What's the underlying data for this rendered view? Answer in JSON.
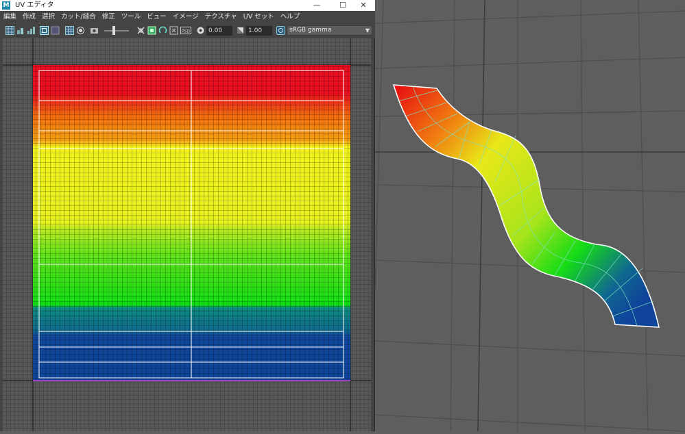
{
  "window": {
    "title": "UV エディタ",
    "logo_letter": "M",
    "controls": {
      "minimize": "—",
      "maximize": "☐",
      "close": "✕"
    }
  },
  "menu": [
    "編集",
    "作成",
    "選択",
    "カット/縫合",
    "修正",
    "ツール",
    "ビュー",
    "イメージ",
    "テクスチャ",
    "UV セット",
    "ヘルプ"
  ],
  "toolbar": {
    "exposure_value": "0.00",
    "gamma_value": "1.00",
    "color_space": "sRGB gamma",
    "icons": [
      "uv-grid-icon",
      "checker-icon",
      "stats-icon",
      "frame-icon",
      "shaded-icon",
      "grid-toggle-icon",
      "snapshot-icon",
      "display-image-icon",
      "dim-image-icon",
      "image-filter-icon",
      "texture-borders-icon",
      "distortion-icon",
      "isolate-icon",
      "psd-icon",
      "exposure-icon",
      "gamma-icon",
      "view-transform-icon"
    ]
  },
  "colors": {
    "background": "#5e5e5e",
    "uv_background": "#444444",
    "band_colors": [
      "#e8101c",
      "#f27a0a",
      "#f2f21c",
      "#c6ea20",
      "#12e014",
      "#0f7f8a",
      "#0f469a"
    ]
  }
}
